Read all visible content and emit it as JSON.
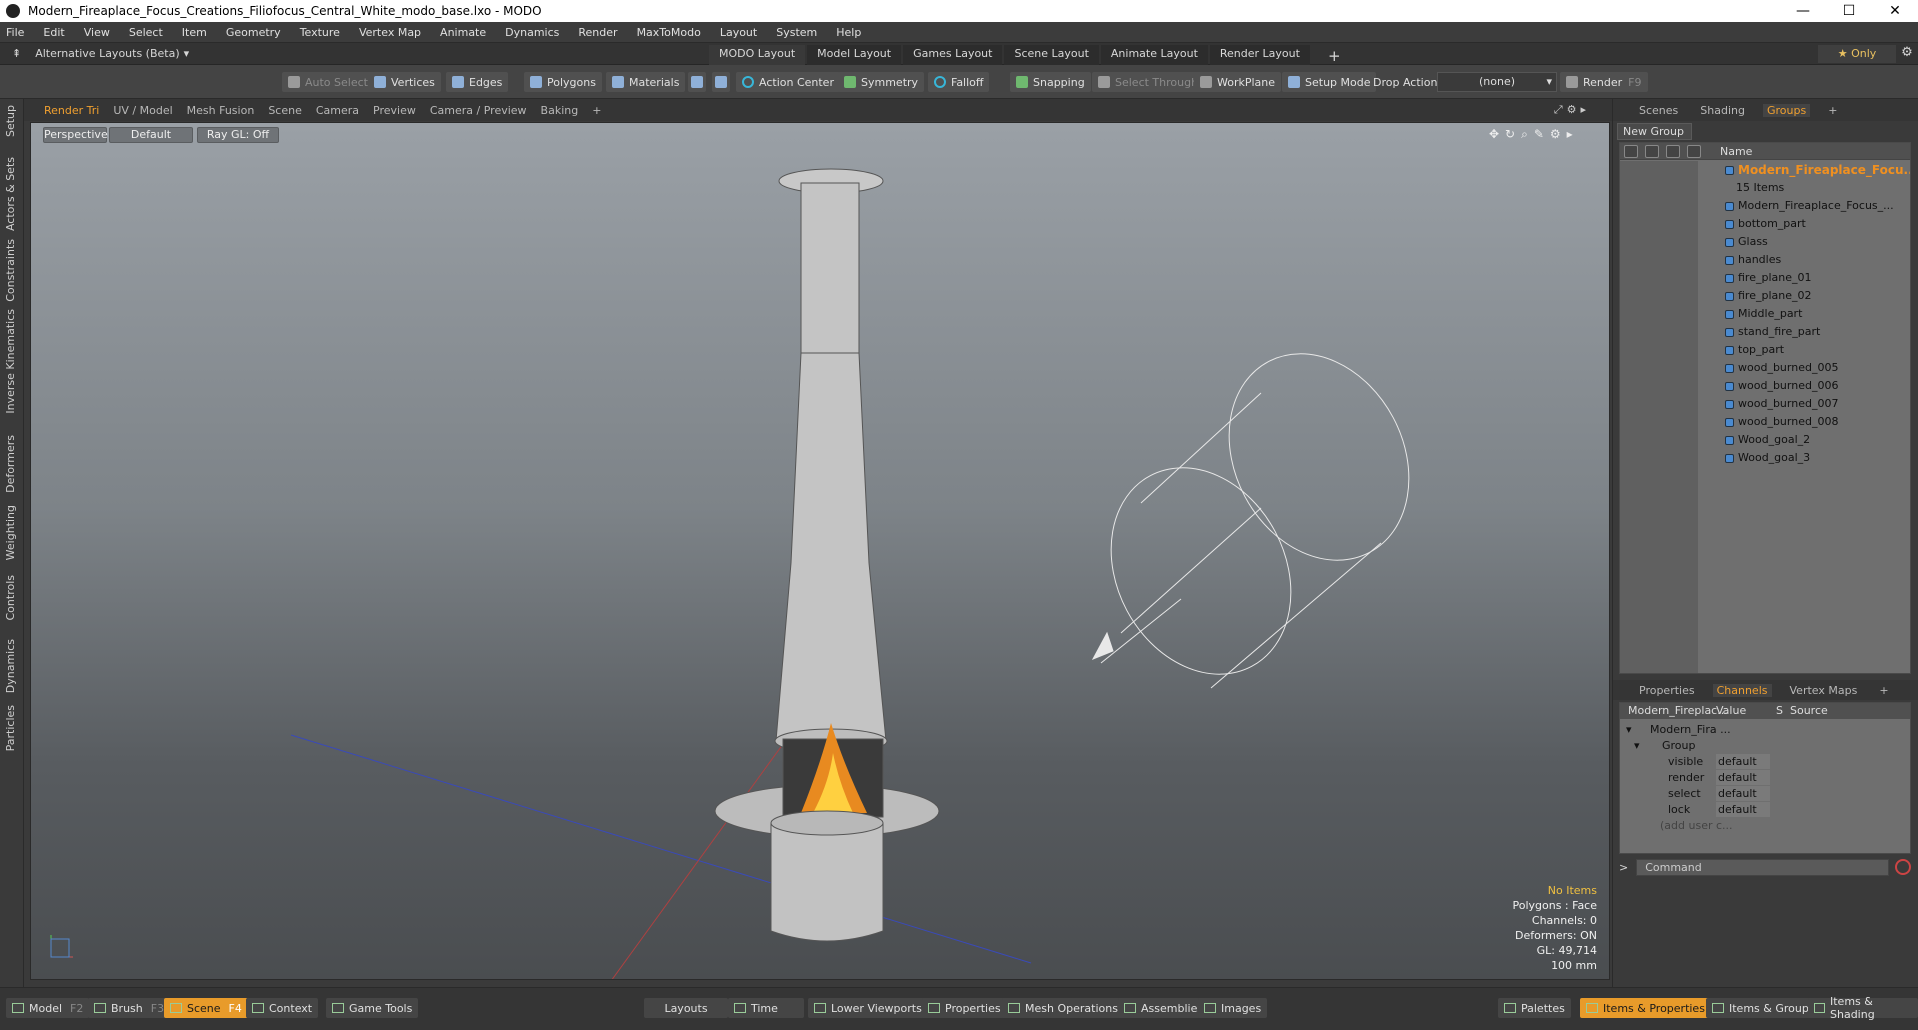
{
  "window": {
    "title": "Modern_Fireaplace_Focus_Creations_Filiofocus_Central_White_modo_base.lxo - MODO",
    "min": "—",
    "max": "☐",
    "close": "✕"
  },
  "menu": [
    "File",
    "Edit",
    "View",
    "Select",
    "Item",
    "Geometry",
    "Texture",
    "Vertex Map",
    "Animate",
    "Dynamics",
    "Render",
    "MaxToModo",
    "Layout",
    "System",
    "Help"
  ],
  "layoutbar": {
    "alt_label": "Alternative Layouts (Beta)",
    "tabs": [
      "MODO Layout",
      "Model Layout",
      "Games Layout",
      "Scene Layout",
      "Animate Layout",
      "Render Layout"
    ],
    "active_tab": "MODO Layout",
    "only": "★  Only"
  },
  "toolbar": {
    "auto_select": "Auto Select",
    "vertices": "Vertices",
    "edges": "Edges",
    "polygons": "Polygons",
    "materials": "Materials",
    "action_center": "Action Center",
    "symmetry": "Symmetry",
    "falloff": "Falloff",
    "snapping": "Snapping",
    "select_through": "Select Through",
    "workplane": "WorkPlane",
    "setup_mode": "Setup Mode",
    "drop_action_label": "Drop Action",
    "drop_action_value": "(none)",
    "render": "Render",
    "render_key": "F9"
  },
  "left_strip": [
    "Setup",
    "Actors & Sets",
    "Constraints",
    "Inverse Kinematics",
    "Deformers",
    "Weighting",
    "Controls",
    "Dynamics",
    "Particles"
  ],
  "viewport_tabs": [
    "Render Tri",
    "UV / Model",
    "Mesh Fusion",
    "Scene",
    "Camera",
    "Preview",
    "Camera / Preview",
    "Baking",
    "+"
  ],
  "viewport": {
    "view": "Perspective",
    "shading": "Default",
    "raygl": "Ray GL: Off",
    "hud": {
      "items": "No Items",
      "polygons": "Polygons : Face",
      "channels": "Channels: 0",
      "deformers": "Deformers: ON",
      "gl": "GL: 49,714",
      "scale": "100 mm"
    }
  },
  "right_tabs": [
    "Scenes",
    "Shading",
    "Groups",
    "+"
  ],
  "groups": {
    "new_group": "New Group",
    "name_header": "Name",
    "root": "Modern_Fireaplace_Focu...",
    "root_count": "15 Items",
    "items": [
      "Modern_Fireaplace_Focus_...",
      "bottom_part",
      "Glass",
      "handles",
      "fire_plane_01",
      "fire_plane_02",
      "Middle_part",
      "stand_fire_part",
      "top_part",
      "wood_burned_005",
      "wood_burned_006",
      "wood_burned_007",
      "wood_burned_008",
      "Wood_goal_2",
      "Wood_goal_3"
    ]
  },
  "props_tabs": [
    "Properties",
    "Channels",
    "Vertex Maps",
    "+"
  ],
  "channels": {
    "headers": {
      "name": "Modern_Fireplac...",
      "value": "Value",
      "s": "S",
      "source": "Source"
    },
    "root": "Modern_Fira ...",
    "group": "Group",
    "rows": [
      {
        "k": "visible",
        "v": "default"
      },
      {
        "k": "render",
        "v": "default"
      },
      {
        "k": "select",
        "v": "default"
      },
      {
        "k": "lock",
        "v": "default"
      }
    ],
    "add": "(add user c..."
  },
  "command": {
    "prompt": ">",
    "placeholder": "Command"
  },
  "status": {
    "model": "Model",
    "model_key": "F2",
    "brush": "Brush",
    "brush_key": "F3",
    "scene": "Scene",
    "scene_key": "F4",
    "context": "Context",
    "game_tools": "Game Tools",
    "layouts": "Layouts",
    "time": "Time",
    "lower": "Lower Viewports",
    "properties": "Properties",
    "mesh_ops": "Mesh Operations",
    "assemblies": "Assemblies",
    "images": "Images",
    "palettes": "Palettes",
    "items_props": "Items & Properties",
    "items_groups": "Items & Groups",
    "items_shading": "Items & Shading"
  },
  "colors": {
    "accent": "#e89b2a",
    "viewport_top": "#9aa0a6",
    "viewport_bottom": "#4a4d50"
  }
}
